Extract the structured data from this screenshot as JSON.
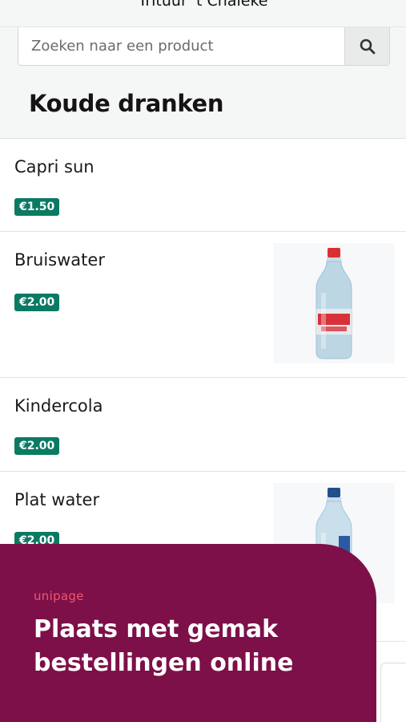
{
  "header": {
    "shop_name": "Trituur 't Chaleke"
  },
  "search": {
    "placeholder": "Zoeken naar een product",
    "icon": "search-icon"
  },
  "category": {
    "title": "Koude dranken"
  },
  "products": [
    {
      "name": "Capri sun",
      "price": "€1.50",
      "has_image": false
    },
    {
      "name": "Bruiswater",
      "price": "€2.00",
      "has_image": true,
      "image": "sparkling-water-bottle"
    },
    {
      "name": "Kindercola",
      "price": "€2.00",
      "has_image": false
    },
    {
      "name": "Plat water",
      "price": "€2.00",
      "has_image": true,
      "image": "still-water-bottle"
    }
  ],
  "promo": {
    "logo": "unipage",
    "headline": "Plaats met gemak bestellingen online"
  },
  "colors": {
    "price_badge": "#0b7a63",
    "promo_bg": "#7d1048",
    "promo_logo": "#f0566e",
    "header_bg": "#f5f6f6"
  }
}
